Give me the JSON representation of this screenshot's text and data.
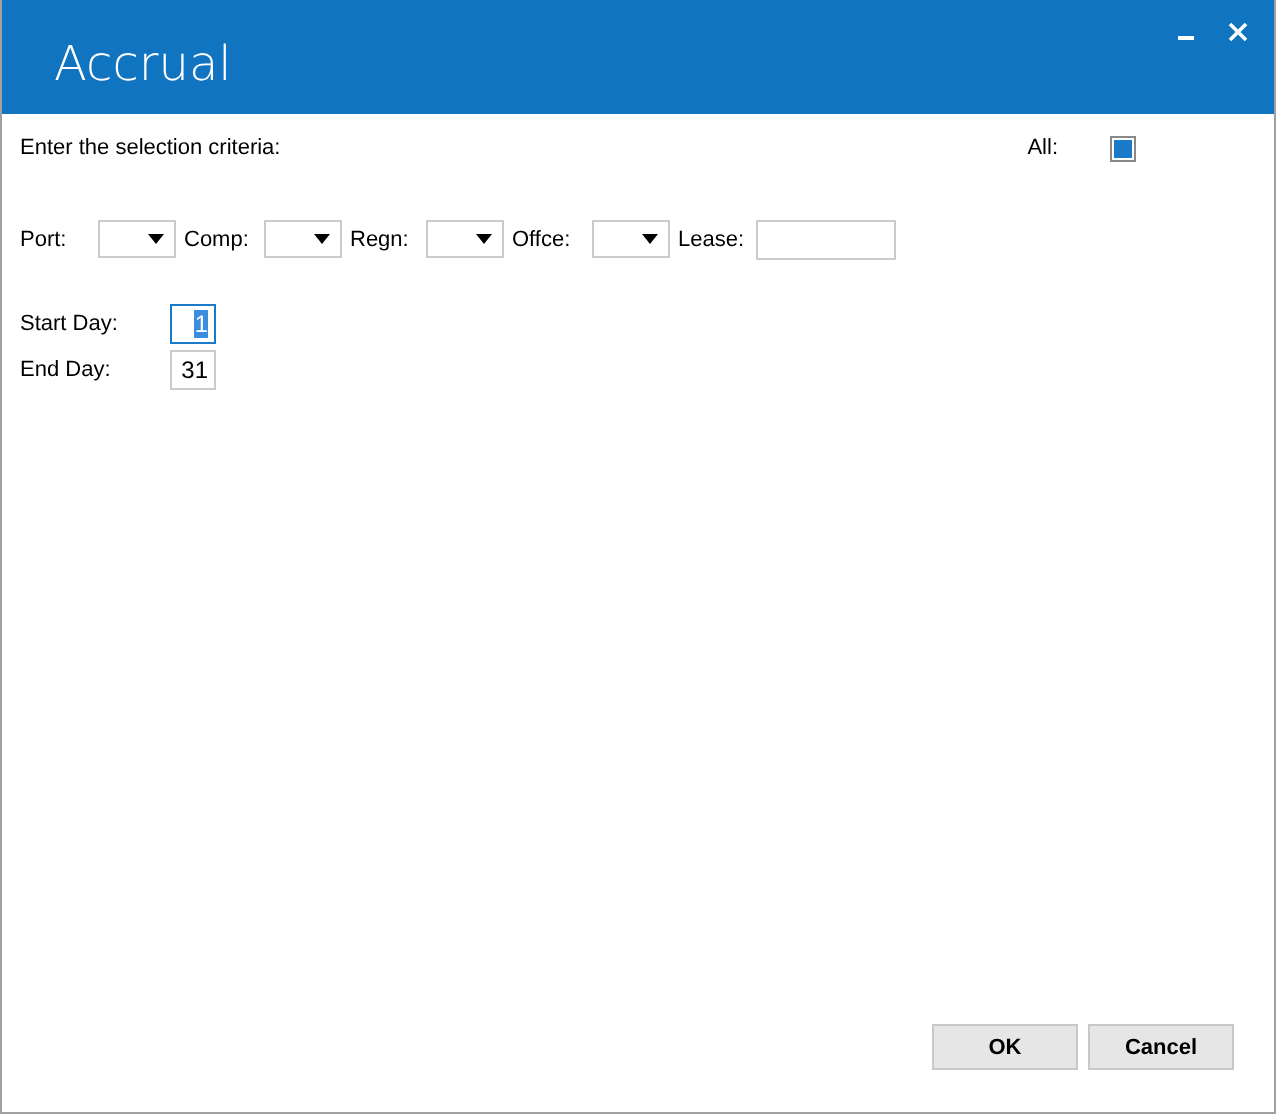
{
  "window": {
    "title": "Accrual"
  },
  "prompt": "Enter the selection criteria:",
  "all": {
    "label": "All:",
    "checked": true
  },
  "criteria": [
    {
      "label": "Port:",
      "kind": "combo"
    },
    {
      "label": "Comp:",
      "kind": "combo"
    },
    {
      "label": "Regn:",
      "kind": "combo"
    },
    {
      "label": "Offce:",
      "kind": "combo"
    },
    {
      "label": "Lease:",
      "kind": "text"
    }
  ],
  "days": [
    {
      "label": "Start Day:",
      "value": "1",
      "focused": true
    },
    {
      "label": "End Day:",
      "value": "31",
      "focused": false
    }
  ],
  "buttons": [
    "OK",
    "Cancel"
  ]
}
